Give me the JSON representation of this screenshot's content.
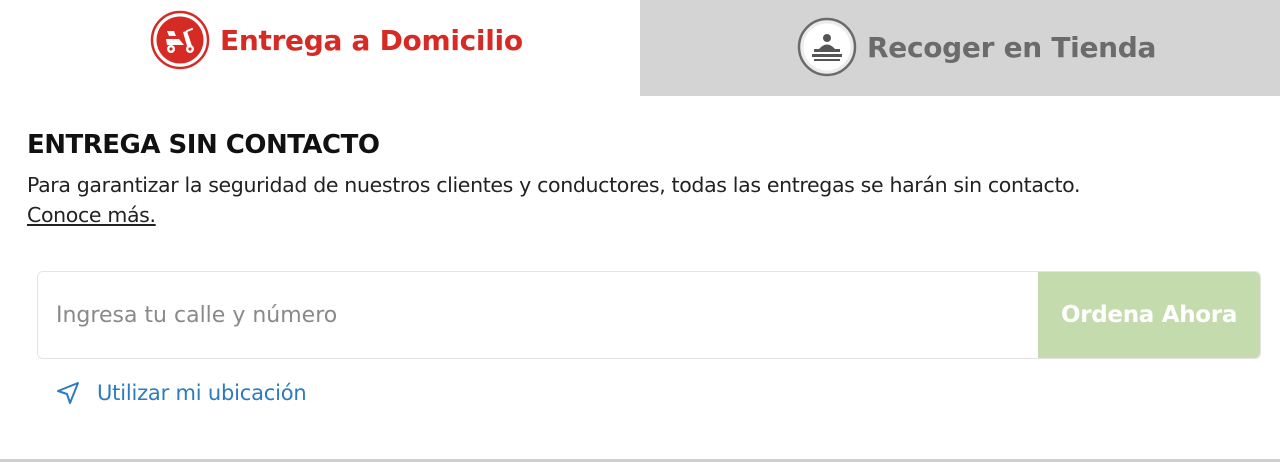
{
  "tabs": [
    {
      "label": "Entrega a Domicilio",
      "icon": "scooter-delivery-icon",
      "active": true
    },
    {
      "label": "Recoger en Tienda",
      "icon": "store-pickup-icon",
      "active": false
    }
  ],
  "notice": {
    "title": "ENTREGA SIN CONTACTO",
    "text": "Para garantizar la seguridad de nuestros clientes y conductores, todas las entregas se harán sin contacto.",
    "link": "Conoce más."
  },
  "address": {
    "placeholder": "Ingresa tu calle y número",
    "button_label": "Ordena Ahora"
  },
  "location": {
    "label": "Utilizar mi ubicación",
    "icon": "location-arrow-icon"
  },
  "colors": {
    "brand_red": "#d62a25",
    "inactive_tab": "#d4d4d4",
    "button_disabled": "#c4dcad",
    "link_blue": "#2b7bc4"
  }
}
